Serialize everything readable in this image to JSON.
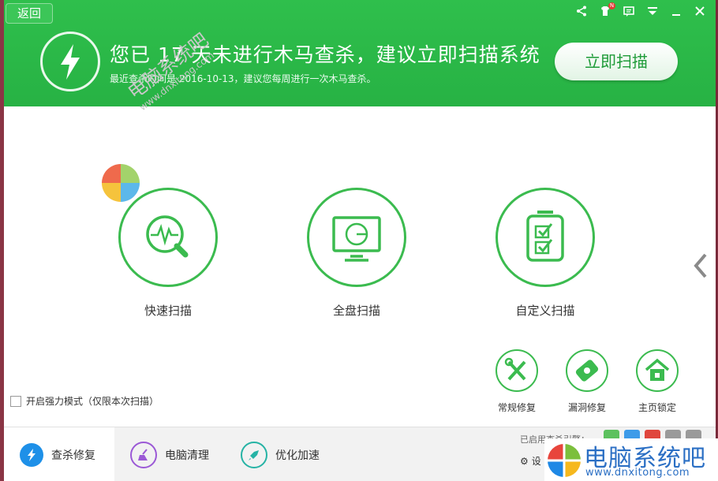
{
  "header": {
    "back_label": "返回",
    "headline": "您已  17  天未进行木马查杀，建议立即扫描系统",
    "subline": "最近查杀时间是 2016-10-13，建议您每周进行一次木马查杀。",
    "scan_now_label": "立即扫描",
    "window_icons": [
      "share-icon",
      "skin-icon",
      "feedback-icon",
      "menu-icon",
      "minimize-icon",
      "close-icon"
    ],
    "badge": "N"
  },
  "watermark": {
    "title": "电脑系统吧",
    "url": "www.dnxitong.com"
  },
  "scan_options": [
    {
      "label": "快速扫描",
      "icon": "pulse-magnifier-icon"
    },
    {
      "label": "全盘扫描",
      "icon": "monitor-disk-icon"
    },
    {
      "label": "自定义扫描",
      "icon": "checklist-icon"
    }
  ],
  "tools": [
    {
      "label": "常规修复",
      "icon": "wrench-screwdriver-icon"
    },
    {
      "label": "漏洞修复",
      "icon": "patch-icon"
    },
    {
      "label": "主页锁定",
      "icon": "home-lock-icon"
    }
  ],
  "strong_mode_label": "开启强力模式（仅限本次扫描）",
  "bottom_tabs": [
    {
      "label": "查杀修复",
      "icon": "bolt-icon",
      "color": "#1e90e8"
    },
    {
      "label": "电脑清理",
      "icon": "broom-icon",
      "color": "#9b59d6"
    },
    {
      "label": "优化加速",
      "icon": "rocket-icon",
      "color": "#26b3a5"
    }
  ],
  "engines_label": "已启用查杀引擎：",
  "engine_colors": [
    "#5cc15e",
    "#3d9be9",
    "#e0463d",
    "#9a9a9a",
    "#9a9a9a"
  ],
  "settings_label": "设",
  "brand": {
    "name": "电脑系统吧",
    "url": "www.dnxitong.com"
  },
  "colors": {
    "accent_green": "#2fbf4c",
    "circle_green": "#3bbb4f"
  }
}
